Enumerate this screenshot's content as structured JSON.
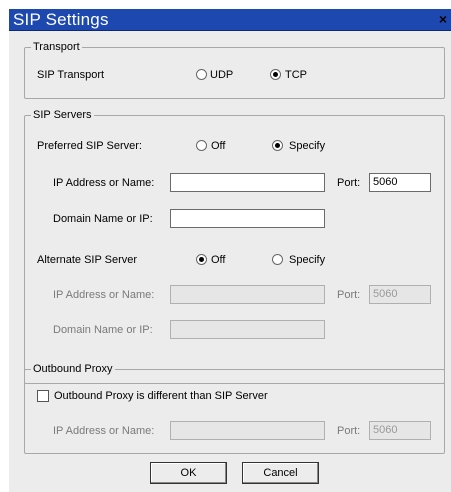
{
  "window": {
    "title": "SIP Settings",
    "close_label": "×"
  },
  "transport": {
    "legend": "Transport",
    "label": "SIP Transport",
    "options": [
      {
        "label": "UDP",
        "checked": false
      },
      {
        "label": "TCP",
        "checked": true
      }
    ]
  },
  "sip_servers": {
    "legend": "SIP Servers",
    "preferred": {
      "label": "Preferred SIP Server:",
      "options": [
        {
          "label": "Off",
          "checked": false
        },
        {
          "label": "Specify",
          "checked": true
        }
      ],
      "ip_label": "IP Address or Name:",
      "ip_value": "",
      "port_label": "Port:",
      "port_value": "5060",
      "domain_label": "Domain Name or IP:",
      "domain_value": ""
    },
    "alternate": {
      "label": "Alternate SIP Server",
      "options": [
        {
          "label": "Off",
          "checked": true
        },
        {
          "label": "Specify",
          "checked": false
        }
      ],
      "ip_label": "IP Address or Name:",
      "ip_value": "",
      "port_label": "Port:",
      "port_value": "5060",
      "domain_label": "Domain Name or IP:",
      "domain_value": ""
    }
  },
  "outbound_proxy": {
    "legend": "Outbound Proxy",
    "checkbox_label": "Outbound Proxy is different than SIP Server",
    "checked": false,
    "ip_label": "IP Address or Name:",
    "ip_value": "",
    "port_label": "Port:",
    "port_value": "5060"
  },
  "buttons": {
    "ok": "OK",
    "cancel": "Cancel"
  }
}
